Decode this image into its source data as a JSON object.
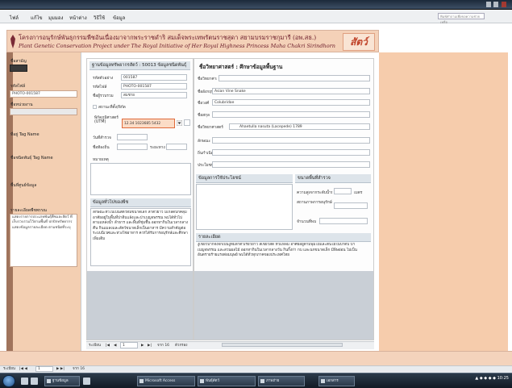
{
  "menubar": {
    "items": [
      "ไฟล์",
      "แก้ไข",
      "มุมมอง",
      "หน้าต่าง",
      "วิธีใช้",
      "ข้อมูล"
    ],
    "help_placeholder": "พิมพ์คำถามเพื่อขอความช่วยเหลือ"
  },
  "banner": {
    "title_th": "โครงการอนุรักษ์พันธุกรรมพืชอันเนื่องมาจากพระราชดำริ สมเด็จพระเทพรัตนราชสุดา สยามบรมราชกุมารี (อพ.สธ.)",
    "title_en": "Plant Genetic Conservation Project under The Royal Initiative of Her Royal Highness Princess Maha Chakri Sirindhorn",
    "mark": "สัตว์"
  },
  "left_panel": {
    "items": [
      {
        "label": "ชื่อสามัญ",
        "value": ""
      },
      {
        "label": "รหัสไฟล์",
        "value": "PHOTO-001587"
      },
      {
        "label": "ชื่อหน่วยงาน",
        "value": ""
      },
      {
        "label": "ที่อยู่ Tag Name",
        "value": ""
      },
      {
        "label": "ชื่อชนิดพันธุ์ Tag Name",
        "value": ""
      },
      {
        "label": "พื้นที่ศูนย์ข้อมูล",
        "value": ""
      },
      {
        "label": "รายละเอียดพืชพรรณ",
        "value": ""
      }
    ],
    "note": "แสดงรายการประเภทพันธุ์พืชและสัตว์ ที่เก็บรวบรวมไว้ตามพื้นที่ ปกปักทรัพยากร แสดงข้อมูลรายละเอียด ตามชนิดที่ระบุ"
  },
  "form": {
    "header": "ฐานข้อมูลทรัพยากรสัตว์ : 50013 ข้อมูลชนิดพันธุ์",
    "fields": [
      {
        "label": "รหัสตัวอย่าง",
        "value": "001587"
      },
      {
        "label": "รหัสไฟล์",
        "value": "PHOTO-001587"
      },
      {
        "label": "ชื่อผู้รวบรวม",
        "value": "สมชาย"
      }
    ],
    "checkbox_label": "สถานะที่ตั้ง/พิกัด",
    "coord_label": "พิกัดภูมิศาสตร์ (UTM)",
    "coord_value": "12.34 1023685 5432",
    "short_fields": [
      {
        "label": "วันที่สำรวจ",
        "value": ""
      },
      {
        "label": "ชื่อท้องถิ่น",
        "value": ""
      },
      {
        "label": "ระยะทาง",
        "value": ""
      }
    ],
    "remarks_label": "หมายเหตุ",
    "desc_header": "ข้อมูลทั่วไปของพืช",
    "desc_text": "ลักษณะทั่วไปเป็นสัตว์ที่มีขนาดเล็ก ลำตัวยาว มีเกล็ดปกคลุม อาศัยอยู่ในพื้นที่ป่าดิบแล้งและป่าเบญจพรรณ พบได้ทั่วไปตามแหล่งน้ำ ลำธาร และพื้นที่ชุ่มชื้น ออกหากินในเวลากลางคืน กินแมลงและสัตว์ขนาดเล็กเป็นอาหาร มีความสำคัญต่อระบบนิเวศและห่วงโซ่อาหาร ควรได้รับการอนุรักษ์และศึกษาเพิ่มเติม"
  },
  "detail": {
    "title": "ชื่อวิทยาศาสตร์ : ศึกษาข้อมูลพื้นฐาน",
    "rows": [
      {
        "label": "ชื่อวิทยาศาสตร์/ชื่อพื้นบ้าน",
        "value": ""
      },
      {
        "label": "ชื่ออังกฤษ",
        "value": "Asian Vine Snake"
      },
      {
        "label": "ชื่อวงศ์",
        "value": "Colubridae"
      },
      {
        "label": "ชื่อสกุล",
        "value": ""
      },
      {
        "label": "ชื่อวิทยาศาสตร์",
        "value": "Ahaetulla nasuta (Lacepede) 1789"
      },
      {
        "label": "ลักษณะ",
        "value": ""
      },
      {
        "label": "ถิ่นกำเนิด",
        "value": ""
      },
      {
        "label": "ประโยชน์",
        "value": ""
      }
    ],
    "sub_left_header": "ข้อมูลการใช้ประโยชน์",
    "sub_right_header": "ขนาดพื้นที่สำรวจ",
    "sub_right_rows": [
      {
        "label": "ความสูงจากระดับน้ำทะเล",
        "value": "",
        "unit": "เมตร"
      },
      {
        "label": "สถานภาพการอนุรักษ์",
        "value": ""
      },
      {
        "label": "จำนวนที่พบ",
        "value": ""
      }
    ],
    "remarks_header": "รายละเอียด",
    "remarks_text": "งูเขียวปากจิ้งจกเป็นงูที่มีลำตัวเรียวยาว สีเขียวสด หัวแหลม อาศัยอยู่ตามพุ่มไม้และต้นไม้ในป่าดิบ ป่าเบญจพรรณ และสวนผลไม้ ออกหากินในเวลากลางวัน กินกิ้งก่า กบ และนกขนาดเล็ก มีพิษอ่อน ไม่เป็นอันตรายร้ายแรงต่อมนุษย์ พบได้ทั่วทุกภาคของประเทศไทย"
  },
  "record_nav": {
    "label": "ระเบียน",
    "current": "1",
    "total_text": "จาก 16",
    "filter_text": "ตัวกรอง"
  },
  "status": {
    "label": "ระเบียน",
    "current": "1",
    "total_text": "จาก 16"
  },
  "taskbar": {
    "tasks": [
      "ฐานข้อมูล",
      "Microsoft Access",
      "พันธุ์สัตว์",
      "ภาพถ่าย",
      "เอกสาร"
    ],
    "tray_text": "▲ ◆ ◆ ◆ ◆ 10:25"
  }
}
